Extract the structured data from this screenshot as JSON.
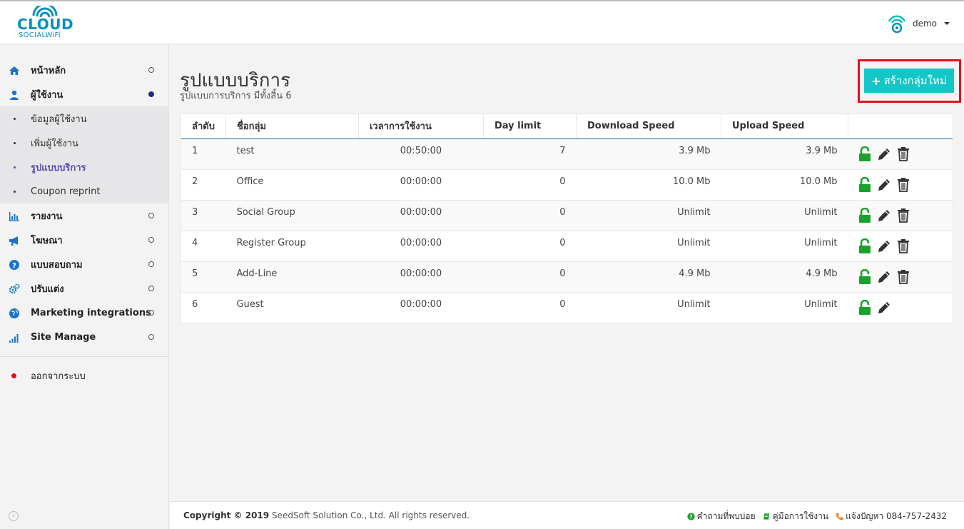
{
  "header": {
    "logo_main": "CLOUD",
    "logo_sub": "SOCIALWiFi",
    "user_name": "demo"
  },
  "sidebar": {
    "items": [
      {
        "label": "หน้าหลัก",
        "icon": "home-icon"
      },
      {
        "label": "ผู้ใช้งาน",
        "icon": "user-icon"
      },
      {
        "label": "รายงาน",
        "icon": "bar-chart-icon"
      },
      {
        "label": "โฆษณา",
        "icon": "megaphone-icon"
      },
      {
        "label": "แบบสอบถาม",
        "icon": "question-circle-icon"
      },
      {
        "label": "ปรับแต่ง",
        "icon": "gears-icon"
      },
      {
        "label": "Marketing integrations",
        "icon": "globe-icon"
      },
      {
        "label": "Site Manage",
        "icon": "signal-icon"
      }
    ],
    "sub_items": [
      {
        "label": "ข้อมูลผู้ใช้งาน"
      },
      {
        "label": "เพิ่มผู้ใช้งาน"
      },
      {
        "label": "รูปแบบบริการ"
      },
      {
        "label": "Coupon reprint"
      }
    ],
    "logout_label": "ออกจากระบบ",
    "collapse_icon": "‹"
  },
  "main": {
    "title": "รูปแบบบริการ",
    "subtitle": "รูปแบบการบริการ มีทั้งสิ้น 6",
    "add_button_label": "สร้างกลุ่มใหม่",
    "add_button_icon": "+",
    "table": {
      "headers": [
        "ลำดับ",
        "ชื่อกลุ่ม",
        "เวลาการใช้งาน",
        "Day limit",
        "Download Speed",
        "Upload Speed",
        ""
      ],
      "rows": [
        {
          "no": "1",
          "name": "test",
          "time": "00:50:00",
          "day_limit": "7",
          "download": "3.9 Mb",
          "upload": "3.9 Mb"
        },
        {
          "no": "2",
          "name": "Office",
          "time": "00:00:00",
          "day_limit": "0",
          "download": "10.0 Mb",
          "upload": "10.0 Mb"
        },
        {
          "no": "3",
          "name": "Social Group",
          "time": "00:00:00",
          "day_limit": "0",
          "download": "Unlimit",
          "upload": "Unlimit"
        },
        {
          "no": "4",
          "name": "Register Group",
          "time": "00:00:00",
          "day_limit": "0",
          "download": "Unlimit",
          "upload": "Unlimit"
        },
        {
          "no": "5",
          "name": "Add-Line",
          "time": "00:00:00",
          "day_limit": "0",
          "download": "4.9 Mb",
          "upload": "4.9 Mb"
        },
        {
          "no": "6",
          "name": "Guest",
          "time": "00:00:00",
          "day_limit": "0",
          "download": "Unlimit",
          "upload": "Unlimit"
        }
      ]
    }
  },
  "footer": {
    "copyright_bold": "Copyright © 2019",
    "copyright_rest": " SeedSoft Solution Co., Ltd. All rights reserved.",
    "link_faq": "คำถามที่พบบ่อย",
    "link_manual": "คู่มือการใช้งาน",
    "link_support": "แจ้งปัญหา 084-757-2432"
  },
  "colors": {
    "accent_teal": "#15c6c8",
    "nav_blue": "#1a73c9",
    "active_purple": "#5a4bb0",
    "unlock_green": "#1aa32c",
    "highlight_red": "#e0111b"
  }
}
